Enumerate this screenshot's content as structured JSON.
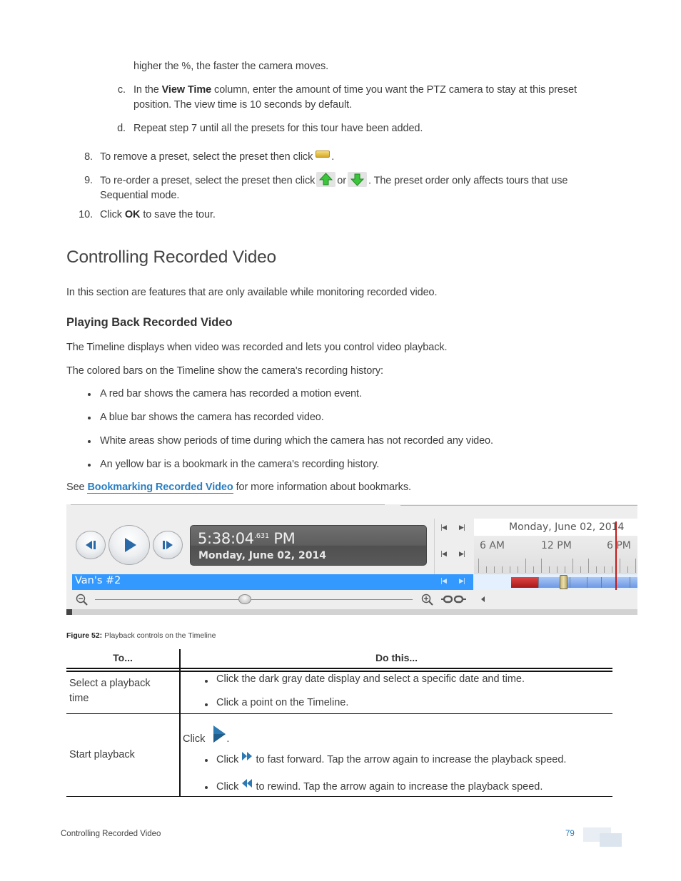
{
  "steps_top": {
    "continuation": "higher the %, the faster the camera moves.",
    "sub_c": {
      "marker": "c.",
      "prefix": "In the ",
      "bold": "View Time",
      "suffix": " column, enter the amount of time you want the PTZ camera to stay at this preset",
      "line2": "position. The view time is 10 seconds by default."
    },
    "sub_d": {
      "marker": "d.",
      "text": "Repeat step 7 until all the presets for this tour have been added."
    },
    "step8": {
      "marker": "8.",
      "text": "To remove a preset, select the preset then click",
      "icon": "remove-preset-icon",
      "end": "."
    },
    "step9": {
      "marker": "9.",
      "text": "To re-order a preset, select the preset then click",
      "icon_up": "move-up-icon",
      "or": "or",
      "icon_down": "move-down-icon",
      "suffix": ". The preset order only affects tours that use",
      "line2": "Sequential mode."
    },
    "step10": {
      "marker": "10.",
      "prefix": "Click ",
      "bold": "OK",
      "suffix": " to save the tour."
    }
  },
  "section": {
    "title": "Controlling Recorded Video",
    "intro": "In this section are features that are only available while monitoring recorded video.",
    "subtitle": "Playing Back Recorded Video",
    "para1": "The Timeline displays when video was recorded and lets you control video playback.",
    "para2": "The colored bars on the Timeline show the camera's recording history:",
    "bullets": [
      "A red bar shows the camera has recorded a motion event.",
      "A blue bar shows the camera has recorded video.",
      "White areas show periods of time during which the camera has not recorded any video.",
      "An yellow bar is a bookmark in the camera's recording history."
    ],
    "see_prefix": "See ",
    "see_link": "Bookmarking Recorded Video",
    "see_suffix": " for more information about bookmarks."
  },
  "figure": {
    "clock_time": "5:38:04",
    "clock_ms": ".631",
    "clock_ampm": " PM",
    "clock_date": "Monday, June 02, 2014",
    "camera_name": "Van's #2",
    "timeline_date": "Monday, June 02, 2014",
    "ruler_labels": [
      "6 AM",
      "12 PM",
      "6 PM"
    ],
    "nav_prev": "|◀",
    "nav_next": "▶|",
    "zoom_slider_position": 0.47,
    "colors": {
      "motion": "#c62828",
      "recorded": "#7fa6ec",
      "camera_row": "#3399ff",
      "cursor": "#c51a1a"
    },
    "caption_label": "Figure 52:",
    "caption_text": " Playback controls on the Timeline"
  },
  "table": {
    "headers": [
      "To...",
      "Do this..."
    ],
    "rows": [
      {
        "action": "Select a playback time",
        "action_l1": "Select a playback",
        "action_l2": "time",
        "bullets": [
          "Click the dark gray date display and select a specific date and time.",
          "Click a point on the Timeline."
        ]
      },
      {
        "action": "Start playback",
        "lead_prefix": "Click",
        "lead_icon": "play-icon",
        "lead_suffix": ".",
        "bullets": [
          {
            "prefix": "Click",
            "icon": "fast-forward-icon",
            "text": " to fast forward. Tap the arrow again to increase the playback speed."
          },
          {
            "prefix": "Click",
            "icon": "rewind-icon",
            "text": " to rewind. Tap the arrow again to increase the playback speed."
          }
        ]
      }
    ]
  },
  "footer": {
    "section": "Controlling Recorded Video",
    "page": "79"
  }
}
